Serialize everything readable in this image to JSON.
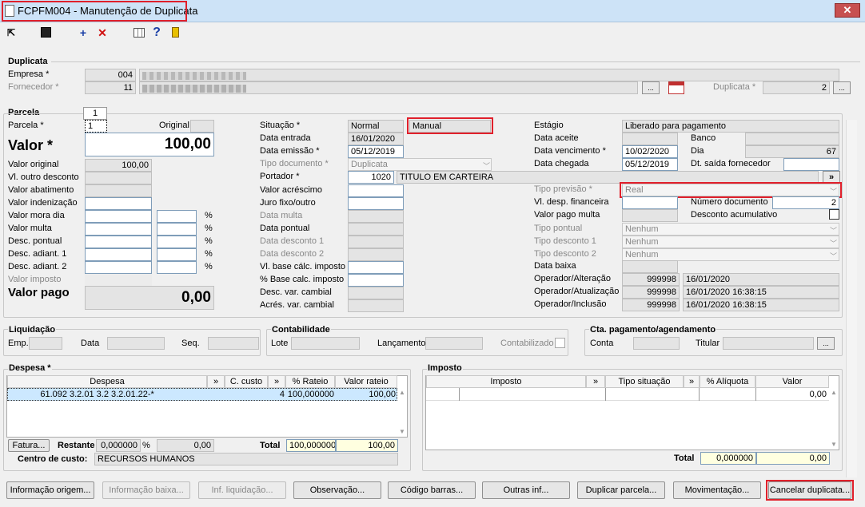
{
  "window": {
    "title": "FCPFM004 - Manutenção de Duplicata",
    "close": "✕"
  },
  "toolbar": {
    "add": "+",
    "remove": "✕",
    "help": "?"
  },
  "duplicata": {
    "section": "Duplicata",
    "empresa_label": "Empresa *",
    "empresa_code": "004",
    "fornecedor_label": "Fornecedor *",
    "fornecedor_code": "11",
    "duplicata_label": "Duplicata *",
    "duplicata_value": "2",
    "dots": "..."
  },
  "parcela": {
    "section": "Parcela",
    "tab": "1",
    "parcela_label": "Parcela *",
    "parcela_value": "1",
    "original_label": "Original",
    "valor_label": "Valor *",
    "valor_value": "100,00",
    "valor_pago_label": "Valor pago",
    "valor_pago_value": "0,00",
    "pct": "%",
    "rows": [
      {
        "label": "Valor original",
        "value": "100,00"
      },
      {
        "label": "Vl. outro desconto",
        "value": ""
      },
      {
        "label": "Valor abatimento",
        "value": ""
      },
      {
        "label": "Valor indenização",
        "value": ""
      },
      {
        "label": "Valor mora dia",
        "value": ""
      },
      {
        "label": "Valor multa",
        "value": ""
      },
      {
        "label": "Desc. pontual",
        "value": ""
      },
      {
        "label": "Desc. adiant. 1",
        "value": ""
      },
      {
        "label": "Desc. adiant. 2",
        "value": ""
      },
      {
        "label": "Valor imposto",
        "value": ""
      }
    ]
  },
  "mid": {
    "situacao_label": "Situação *",
    "situacao_value": "Normal",
    "manual_value": "Manual",
    "data_entrada_label": "Data entrada",
    "data_entrada": "16/01/2020",
    "data_emissao_label": "Data emissão *",
    "data_emissao": "05/12/2019",
    "tipo_doc_label": "Tipo documento *",
    "tipo_doc": "Duplicata",
    "portador_label": "Portador *",
    "portador_code": "1020",
    "portador_name": "TITULO EM CARTEIRA",
    "valor_acrescimo": "Valor acréscimo",
    "juro": "Juro fixo/outro",
    "data_multa": "Data multa",
    "data_pontual": "Data pontual",
    "data_desc1": "Data desconto 1",
    "data_desc2": "Data desconto 2",
    "vl_base": "Vl. base cálc. imposto",
    "pct_base": "% Base calc. imposto",
    "desc_var": "Desc. var. cambial",
    "acres_var": "Acrés. var. cambial"
  },
  "right": {
    "estagio_label": "Estágio",
    "estagio_value": "Liberado para pagamento",
    "data_aceite": "Data aceite",
    "banco": "Banco",
    "data_venc_label": "Data vencimento *",
    "data_venc": "10/02/2020",
    "dia_label": "Dia",
    "dia_value": "67",
    "data_chegada_label": "Data chegada",
    "data_chegada": "05/12/2019",
    "dt_saida": "Dt. saída fornecedor",
    "tipo_prev_label": "Tipo previsão *",
    "tipo_prev": "Real",
    "vl_desp_fin": "Vl. desp. financeira",
    "num_doc_label": "Número documento",
    "num_doc": "2",
    "valor_pago_multa": "Valor pago multa",
    "desc_acum": "Desconto acumulativo",
    "tipo_pontual": "Tipo pontual",
    "tipo_desc1": "Tipo desconto 1",
    "tipo_desc2": "Tipo desconto 2",
    "nenhum": "Nenhum",
    "data_baixa": "Data baixa",
    "op_alt_label": "Operador/Alteração",
    "op_alt_code": "999998",
    "op_alt_date": "16/01/2020",
    "op_atu_label": "Operador/Atualização",
    "op_atu_code": "999998",
    "op_atu_date": "16/01/2020 16:38:15",
    "op_inc_label": "Operador/Inclusão",
    "op_inc_code": "999998",
    "op_inc_date": "16/01/2020 16:38:15"
  },
  "liquidacao": {
    "section": "Liquidação",
    "emp": "Emp.",
    "data": "Data",
    "seq": "Seq."
  },
  "contabilidade": {
    "section": "Contabilidade",
    "lote": "Lote",
    "lancamento": "Lançamento",
    "contabilizado": "Contabilizado"
  },
  "cta": {
    "section": "Cta. pagamento/agendamento",
    "conta": "Conta",
    "titular": "Titular"
  },
  "despesa": {
    "section": "Despesa *",
    "headers": [
      "Despesa",
      "»",
      "C. custo",
      "»",
      "% Rateio",
      "Valor rateio"
    ],
    "row": {
      "code": "61.092",
      "desc": "3.2.01 3.2 3.2.01.22-*",
      "ccusto": "4",
      "rateio": "100,000000",
      "valor": "100,00"
    },
    "fatura_btn": "Fatura...",
    "restante_label": "Restante",
    "restante_pct": "0,000000",
    "pct": "%",
    "restante_val": "0,00",
    "total_label": "Total",
    "total_pct": "100,000000",
    "total_val": "100,00",
    "centro_label": "Centro de custo:",
    "centro_value": "RECURSOS HUMANOS"
  },
  "imposto": {
    "section": "Imposto",
    "headers": [
      "Imposto",
      "»",
      "Tipo situação",
      "»",
      "% Alíquota",
      "Valor"
    ],
    "row_valor": "0,00",
    "total_label": "Total",
    "total_pct": "0,000000",
    "total_val": "0,00"
  },
  "buttons": [
    "Informação origem...",
    "Informação baixa...",
    "Inf. liquidação...",
    "Observação...",
    "Código barras...",
    "Outras inf...",
    "Duplicar parcela...",
    "Movimentação...",
    "Cancelar duplicata..."
  ],
  "colors": {
    "red_highlight": "#e0202b",
    "selection": "#cce8ff",
    "yellow": "#ffffe0"
  }
}
